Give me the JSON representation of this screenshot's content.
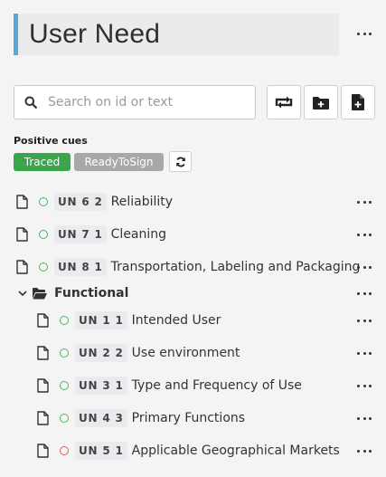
{
  "header": {
    "title": "User Need"
  },
  "search": {
    "placeholder": "Search on id or text"
  },
  "toolbar": {
    "icons": [
      "sync-icon",
      "add-folder-icon",
      "add-document-icon"
    ]
  },
  "cues": {
    "label": "Positive cues",
    "badges": [
      {
        "label": "Traced",
        "color": "#3aa54a"
      },
      {
        "label": "ReadyToSign",
        "color": "#a8a8a8"
      }
    ]
  },
  "items": [
    {
      "id": "UN 6 2",
      "label": "Reliability",
      "status": "green"
    },
    {
      "id": "UN 7 1",
      "label": "Cleaning",
      "status": "green"
    },
    {
      "id": "UN 8 1",
      "label": "Transportation, Labeling and Packaging",
      "status": "green"
    }
  ],
  "folder": {
    "label": "Functional",
    "items": [
      {
        "id": "UN 1 1",
        "label": "Intended User",
        "status": "green"
      },
      {
        "id": "UN 2 2",
        "label": "Use environment",
        "status": "green"
      },
      {
        "id": "UN 3 1",
        "label": "Type and Frequency of Use",
        "status": "green"
      },
      {
        "id": "UN 4 3",
        "label": "Primary Functions",
        "status": "green"
      },
      {
        "id": "UN 5 1",
        "label": "Applicable Geographical Markets",
        "status": "red"
      }
    ]
  },
  "colors": {
    "accent": "#5ba8d8",
    "status_green": "#4cb85a",
    "status_red": "#e05a5a"
  }
}
